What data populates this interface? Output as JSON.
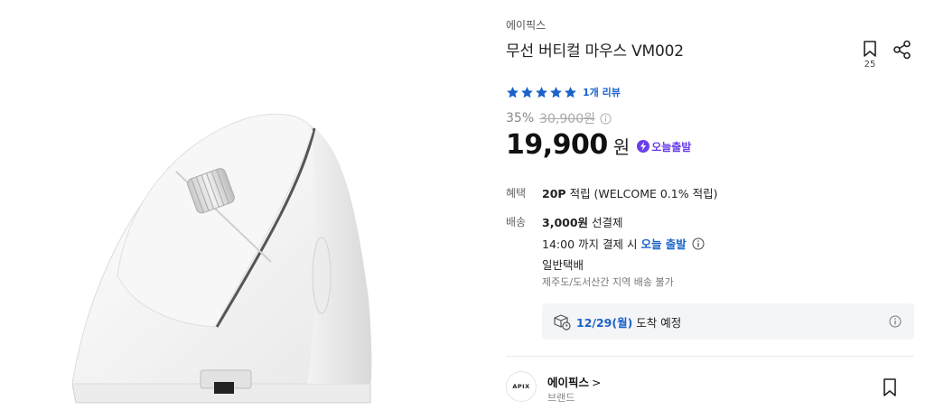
{
  "product": {
    "brand": "에이픽스",
    "title": "무선 버티컬 마우스 VM002",
    "bookmark_count": "25",
    "rating_stars": 5,
    "review_link": "1개 리뷰",
    "discount_rate": "35%",
    "original_price": "30,900원",
    "price": "19,900",
    "currency": "원",
    "today_badge": "오늘출발"
  },
  "benefit": {
    "label": "혜택",
    "points": "20P",
    "detail": "적립 (WELCOME 0.1% 적립)"
  },
  "shipping": {
    "label": "배송",
    "fee": "3,000원",
    "fee_type": "선결제",
    "deadline_text": "14:00 까지 결제 시",
    "deadline_highlight": "오늘 출발",
    "method": "일반택배",
    "restriction": "제주도/도서산간 지역 배송 불가"
  },
  "arrival": {
    "date": "12/29(월)",
    "text": "도착 예정"
  },
  "store": {
    "logo_text": "APIX",
    "name": "에이픽스",
    "chevron": ">",
    "type": "브랜드"
  },
  "colors": {
    "accent_blue": "#1b63c9",
    "badge_purple": "#6a3ee8",
    "star_blue": "#1b63c9"
  },
  "icons": [
    "bookmark-icon",
    "share-icon",
    "star-icon",
    "info-icon",
    "bolt-icon",
    "delivery-box-icon"
  ]
}
